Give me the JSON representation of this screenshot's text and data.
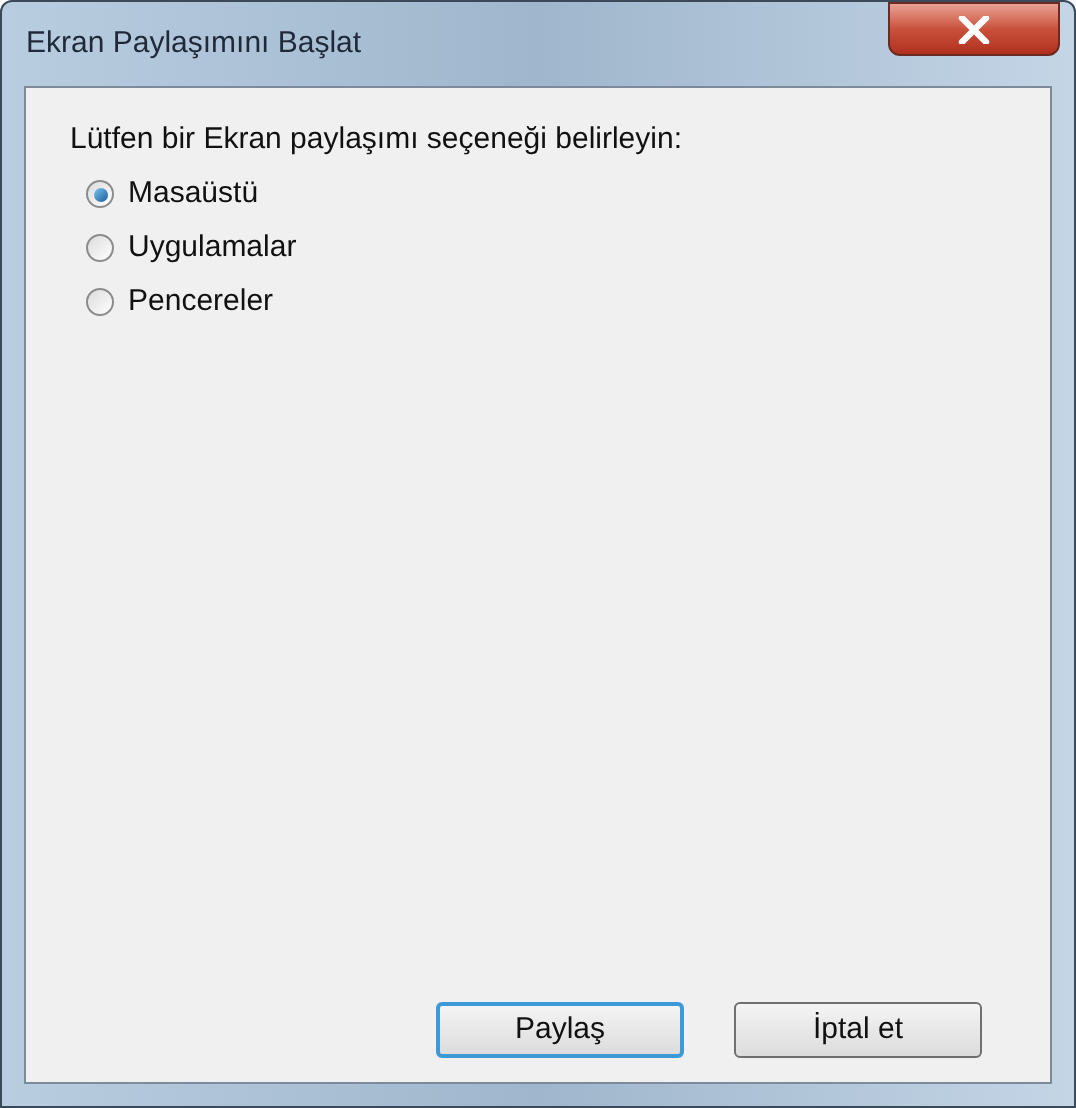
{
  "window": {
    "title": "Ekran Paylaşımını Başlat"
  },
  "prompt": "Lütfen bir Ekran paylaşımı seçeneği belirleyin:",
  "options": [
    {
      "label": "Masaüstü",
      "selected": true
    },
    {
      "label": "Uygulamalar",
      "selected": false
    },
    {
      "label": "Pencereler",
      "selected": false
    }
  ],
  "buttons": [
    {
      "label": "Paylaş",
      "default": true
    },
    {
      "label": "İptal et",
      "default": false
    }
  ]
}
